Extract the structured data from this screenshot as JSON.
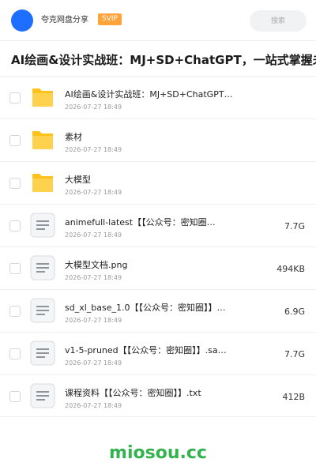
{
  "header": {
    "username": "夸克网盘分享",
    "badge": "SVIP",
    "search_placeholder": "搜索"
  },
  "title": "AI绘画&设计实战班：MJ+SD+ChatGPT，一站式掌握未…",
  "files": [
    {
      "type": "folder",
      "name": "AI绘画&设计实战班：MJ+SD+ChatGPT，…",
      "date": "2026-07-27 18:49",
      "size": ""
    },
    {
      "type": "folder",
      "name": "素材",
      "date": "2026-07-27 18:49",
      "size": ""
    },
    {
      "type": "folder",
      "name": "大模型",
      "date": "2026-07-27 18:49",
      "size": ""
    },
    {
      "type": "file",
      "name": "animefull-latest【【公众号：密知圈…",
      "date": "2026-07-27 18:49",
      "size": "7.7G"
    },
    {
      "type": "file",
      "name": "大模型文档.png",
      "date": "2026-07-27 18:49",
      "size": "494KB"
    },
    {
      "type": "file",
      "name": "sd_xl_base_1.0【【公众号：密知圈】】…",
      "date": "2026-07-27 18:49",
      "size": "6.9G"
    },
    {
      "type": "file",
      "name": "v1-5-pruned【【公众号：密知圈】】.sa…",
      "date": "2026-07-27 18:49",
      "size": "7.7G"
    },
    {
      "type": "file",
      "name": "课程资料【【公众号：密知圈】】.txt",
      "date": "2026-07-27 18:49",
      "size": "412B"
    }
  ],
  "footer": {
    "watermark": "miosou.cc"
  },
  "colors": {
    "avatar": "#1e6fff",
    "svip": "#ffa33a",
    "folder": "#ffc21a",
    "watermark": "#33b34d"
  },
  "icons": {
    "folder": "folder-icon",
    "file": "document-icon"
  }
}
